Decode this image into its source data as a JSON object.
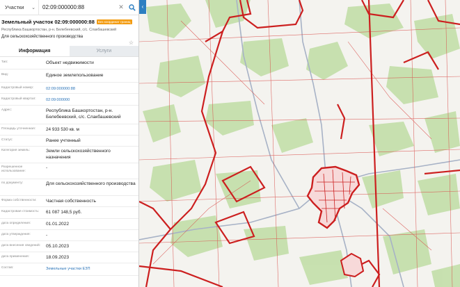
{
  "search": {
    "type_label": "Участки",
    "value": "02:09:000000:88"
  },
  "parcel": {
    "title": "Земельный участок 02:09:000000:88",
    "badge": "Без координат границ",
    "address_short": "Республика Башкортостан, р-н. Белебеевский, с/с. Слакбашевский",
    "purpose_short": "Для сельскохозяйственного производства"
  },
  "tabs": [
    {
      "label": "Информация"
    },
    {
      "label": "Услуги"
    }
  ],
  "fields": [
    {
      "key": "Тип:",
      "value": "Объект недвижимости"
    },
    {
      "key": "Вид:",
      "value": "Единое землепользование"
    },
    {
      "key": "Кадастровый номер:",
      "value": "02:09:000000:88"
    },
    {
      "key": "Кадастровый квартал:",
      "value": "02:09:000000"
    },
    {
      "key": "Адрес:",
      "value": "Республика Башкортостан, р-н. Белебеевский, с/с. Слакбашевский"
    },
    {
      "key": "Площадь уточненная:",
      "value": "24 933 530 кв. м"
    },
    {
      "key": "Статус:",
      "value": "Ранее учтенный"
    },
    {
      "key": "Категория земель:",
      "value": "Земли сельскохозяйственного назначения"
    },
    {
      "key": "Разрешенное использование:",
      "value": "-"
    },
    {
      "key": "по документу:",
      "value": "Для сельскохозяйственного производства"
    },
    {
      "key": "Форма собственности:",
      "value": "Частная собственность"
    },
    {
      "key": "Кадастровая стоимость:",
      "value": "61 087 148,5 руб."
    },
    {
      "key": "дата определения:",
      "value": "01.01.2022"
    },
    {
      "key": "дата утверждения:",
      "value": "-"
    },
    {
      "key": "дата внесения сведений:",
      "value": "05.10.2023"
    },
    {
      "key": "дата применения:",
      "value": "18.09.2023"
    },
    {
      "key": "Состав:",
      "value": "Земельные участки ЕЗП"
    }
  ],
  "colors": {
    "parcel_border": "#cc1f1f",
    "forest": "#c3dfa9",
    "road": "#a7b2c6",
    "link": "#2b74b8",
    "badge": "#f39c12",
    "search_button": "#2d7fc1"
  },
  "icons": [
    "chevron-down-icon",
    "close-icon",
    "search-icon",
    "star-icon"
  ]
}
